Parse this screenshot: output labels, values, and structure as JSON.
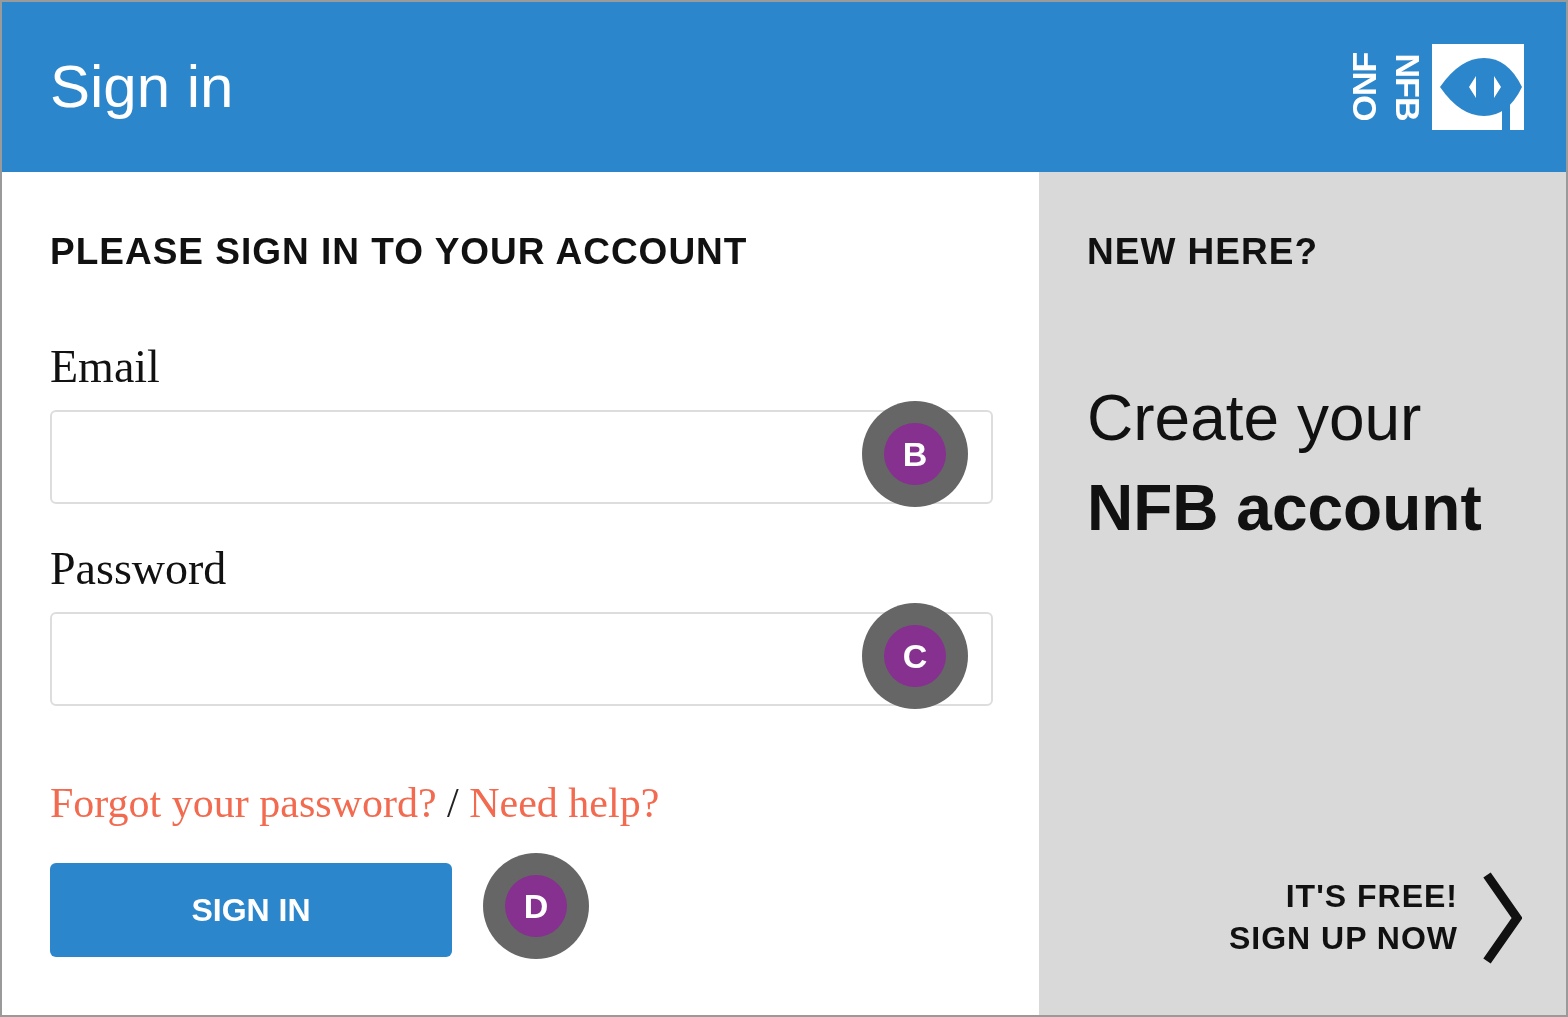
{
  "header": {
    "title": "Sign in",
    "logo": {
      "left_text": "ONF",
      "right_text": "NFB"
    }
  },
  "form": {
    "heading": "PLEASE SIGN IN TO YOUR ACCOUNT",
    "fields": [
      {
        "label": "Email",
        "marker": "B"
      },
      {
        "label": "Password",
        "marker": "C"
      }
    ],
    "links": [
      {
        "text": "Forgot your password?"
      },
      {
        "text": "Need help?"
      }
    ],
    "link_separator": "/",
    "button": {
      "label": "SIGN IN",
      "marker": "D"
    }
  },
  "aside": {
    "heading": "NEW HERE?",
    "title_line_1": "Create your",
    "title_line_2": "NFB account",
    "cta_line_1": "IT'S FREE!",
    "cta_line_2": "SIGN UP NOW"
  }
}
